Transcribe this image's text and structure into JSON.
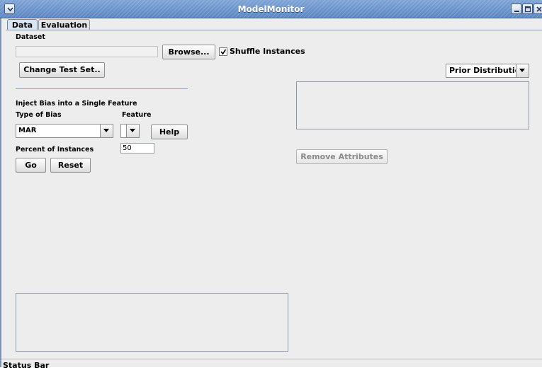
{
  "window": {
    "title": "ModelMonitor"
  },
  "tabs": [
    {
      "label": "Data"
    },
    {
      "label": "Evaluation"
    }
  ],
  "dataset": {
    "section_label": "Dataset",
    "path_value": "",
    "browse_label": "Browse...",
    "shuffle_label": "Shuffle Instances",
    "shuffle_checked": true,
    "change_test_set_label": "Change Test Set.."
  },
  "prior": {
    "selected": "Prior Distribution"
  },
  "bias": {
    "heading": "Inject Bias into a Single Feature",
    "type_label": "Type of Bias",
    "feature_label": "Feature",
    "type_selected": "MAR",
    "feature_selected": "",
    "help_label": "Help",
    "percent_label": "Percent of Instances",
    "percent_value": "50",
    "go_label": "Go",
    "reset_label": "Reset"
  },
  "attributes": {
    "remove_label": "Remove Attributes"
  },
  "status": {
    "text": "Status Bar"
  },
  "colors": {
    "title_bar": "#6f96cd",
    "window_bg": "#ededed",
    "tab_active": "#dbe4f1"
  }
}
